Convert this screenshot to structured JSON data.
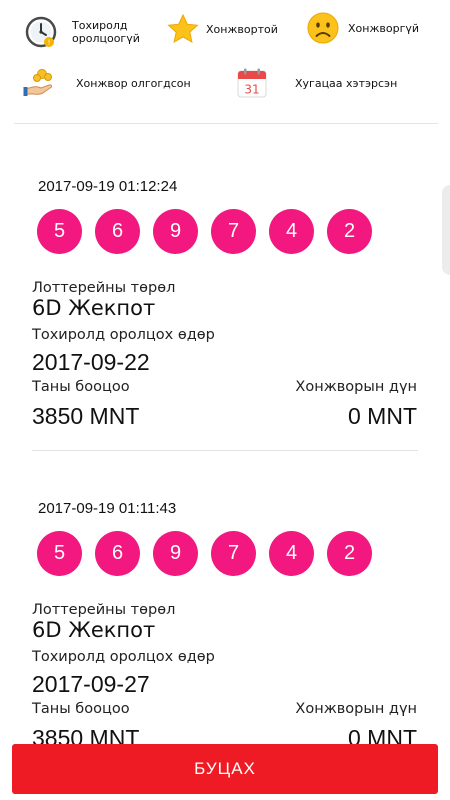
{
  "legend": {
    "items": [
      {
        "label": "Тохиролд\nоролцоогүй",
        "icon": "clock-icon"
      },
      {
        "label": "Хонжвортой",
        "icon": "star-icon"
      },
      {
        "label": "Хонжворгүй",
        "icon": "sad-face-icon"
      },
      {
        "label": "Хонжвор олгогдсон",
        "icon": "coins-hand-icon"
      },
      {
        "label": "Хугацаа хэтэрсэн",
        "icon": "calendar-icon",
        "calendar_day": "31"
      }
    ]
  },
  "tickets": [
    {
      "datetime": "2017-09-19 01:12:24",
      "numbers": [
        "5",
        "6",
        "9",
        "7",
        "4",
        "2"
      ],
      "type_label": "Лоттерейны төрөл",
      "type_value": "6D Жекпот",
      "date_label": "Тохиролд оролцох өдөр",
      "date_value": "2017-09-22",
      "amount_label": "Таны бооцоо",
      "amount_value": "3850 MNT",
      "win_label": "Хонжворын дүн",
      "win_value": "0 MNT"
    },
    {
      "datetime": "2017-09-19 01:11:43",
      "numbers": [
        "5",
        "6",
        "9",
        "7",
        "4",
        "2"
      ],
      "type_label": "Лоттерейны төрөл",
      "type_value": "6D Жекпот",
      "date_label": "Тохиролд оролцох өдөр",
      "date_value": "2017-09-27",
      "amount_label": "Таны бооцоо",
      "amount_value": "3850 MNT",
      "win_label": "Хонжворын дүн",
      "win_value": "0 MNT"
    }
  ],
  "footer": {
    "back_label": "БУЦАХ"
  },
  "colors": {
    "ball": "#f2187f",
    "button": "#ef1b24"
  }
}
